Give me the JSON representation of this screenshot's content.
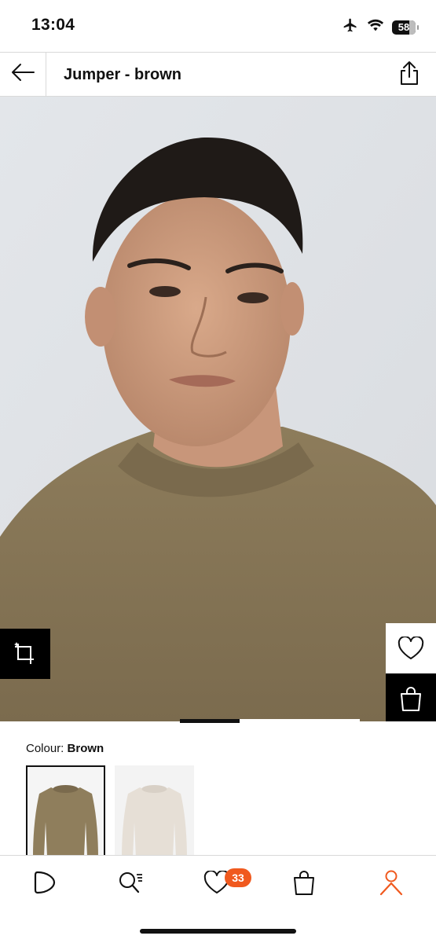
{
  "status_bar": {
    "time": "13:04",
    "battery": "58",
    "icons": [
      "airplane-icon",
      "wifi-icon",
      "battery-icon"
    ]
  },
  "header": {
    "title": "Jumper - brown",
    "back_icon": "arrow-left-icon",
    "share_icon": "share-icon"
  },
  "product": {
    "colour_label": "Colour:",
    "colour_value": "Brown",
    "swatches": [
      {
        "name": "Brown",
        "color": "#8f7e5c",
        "selected": true
      },
      {
        "name": "Ecru",
        "color": "#e6dfd6",
        "selected": false
      }
    ],
    "image_pager": {
      "current": 1,
      "total": 3
    }
  },
  "actions": {
    "crop_icon": "visual-search-icon",
    "favorite_icon": "heart-icon",
    "bag_icon": "bag-icon"
  },
  "bottom_nav": {
    "items": [
      {
        "icon": "home-icon"
      },
      {
        "icon": "search-icon"
      },
      {
        "icon": "favorites-icon",
        "badge": "33"
      },
      {
        "icon": "bag-icon"
      },
      {
        "icon": "profile-icon",
        "active": true
      }
    ]
  },
  "colors": {
    "accent": "#f0591e",
    "sweater": "#8f7e5c",
    "background": "#e8eaec"
  }
}
